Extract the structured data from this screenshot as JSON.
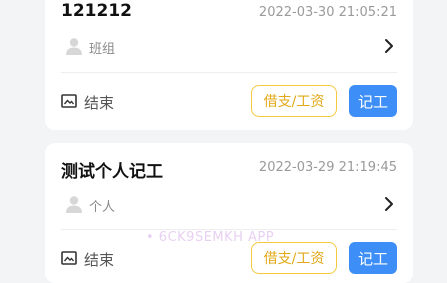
{
  "records": [
    {
      "title": "121212",
      "datetime": "2022-03-30 21:05:21",
      "group": "班组",
      "status": "结束",
      "loan_button": "借支/工资",
      "record_button": "记工"
    },
    {
      "title": "测试个人记工",
      "datetime": "2022-03-29 21:19:45",
      "group": "个人",
      "status": "结束",
      "loan_button": "借支/工资",
      "record_button": "记工"
    }
  ],
  "watermark": "• 6CK9SEMKH APP",
  "colors": {
    "background": "#f3f4f6",
    "card": "#ffffff",
    "accent_blue": "#3d8ff7",
    "accent_yellow": "#f5c93f",
    "muted_text": "#9a9a9a"
  },
  "icons": [
    "person-icon",
    "chevron-right-icon",
    "image-icon"
  ]
}
